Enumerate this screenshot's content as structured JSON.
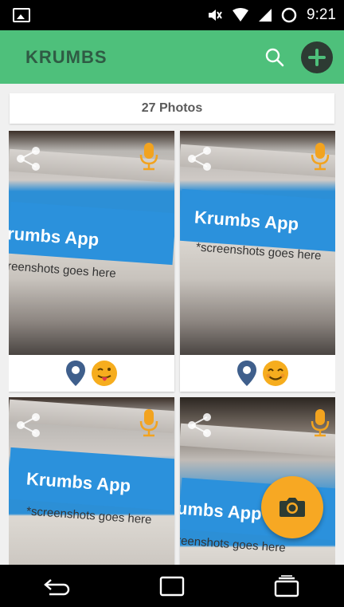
{
  "status_bar": {
    "time": "9:21",
    "icons": [
      "image-notification-icon",
      "mute-icon",
      "wifi-icon",
      "signal-icon",
      "battery-icon"
    ]
  },
  "app_bar": {
    "title": "KRUMBS",
    "color": "#4ec07b",
    "actions": [
      "search-icon",
      "add-icon"
    ]
  },
  "summary": {
    "count_label": "27 Photos"
  },
  "photos": [
    {
      "brand": "rumbs App",
      "caption": "reenshots goes here",
      "reaction": "tongue-out-emoji"
    },
    {
      "brand": "Krumbs App",
      "caption": "*screenshots goes here",
      "reaction": "smiling-emoji"
    },
    {
      "brand": "Krumbs App",
      "caption": "*screenshots goes here",
      "reaction": ""
    },
    {
      "brand": "umbs App",
      "caption": "reenshots goes here",
      "reaction": ""
    }
  ],
  "fab": {
    "icon": "camera-icon",
    "color": "#f7a823"
  },
  "nav_bar": {
    "buttons": [
      "back-icon",
      "home-icon",
      "recents-icon"
    ]
  }
}
